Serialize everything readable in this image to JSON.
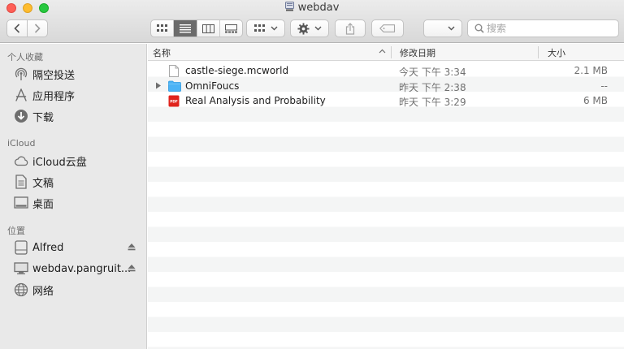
{
  "window": {
    "title": "webdav",
    "title_icon": "network-drive-icon"
  },
  "toolbar": {
    "nav": {
      "back_icon": "chevron-left-icon",
      "forward_icon": "chevron-right-icon"
    },
    "view_modes": [
      {
        "name": "icon-view",
        "icon": "grid-icon",
        "active": false
      },
      {
        "name": "list-view",
        "icon": "list-icon",
        "active": true
      },
      {
        "name": "column-view",
        "icon": "columns-icon",
        "active": false
      },
      {
        "name": "gallery-view",
        "icon": "gallery-icon",
        "active": false
      }
    ],
    "group_icon": "group-grid-icon",
    "action_icon": "gear-icon",
    "share_icon": "share-icon",
    "tag_icon": "tag-icon",
    "search": {
      "placeholder": "搜索",
      "value": ""
    }
  },
  "sidebar": {
    "sections": [
      {
        "title": "个人收藏",
        "items": [
          {
            "label": "隔空投送",
            "icon": "airdrop-icon"
          },
          {
            "label": "应用程序",
            "icon": "applications-icon"
          },
          {
            "label": "下载",
            "icon": "download-icon"
          }
        ]
      },
      {
        "title": "iCloud",
        "items": [
          {
            "label": "iCloud云盘",
            "icon": "cloud-icon"
          },
          {
            "label": "文稿",
            "icon": "document-icon"
          },
          {
            "label": "桌面",
            "icon": "desktop-icon"
          }
        ]
      },
      {
        "title": "位置",
        "items": [
          {
            "label": "Alfred",
            "icon": "disk-icon",
            "ejectable": true
          },
          {
            "label": "webdav.pangruit...",
            "icon": "monitor-icon",
            "ejectable": true
          },
          {
            "label": "网络",
            "icon": "network-globe-icon"
          }
        ]
      }
    ]
  },
  "list": {
    "columns": {
      "name": "名称",
      "date": "修改日期",
      "size": "大小"
    },
    "files": [
      {
        "name": "castle-siege.mcworld",
        "date": "今天 下午 3:34",
        "size": "2.1 MB",
        "kind": "file",
        "icon": "file-icon"
      },
      {
        "name": "OmniFoucs",
        "date": "昨天 下午 2:38",
        "size": "--",
        "kind": "folder",
        "icon": "folder-icon"
      },
      {
        "name": "Real Analysis and Probability",
        "date": "昨天 下午 3:29",
        "size": "6 MB",
        "kind": "pdf",
        "icon": "pdf-icon",
        "badge": "PDF"
      }
    ]
  },
  "colors": {
    "accent_folder": "#4bb3f5",
    "pdf_red": "#e0231c",
    "close": "#fe5f57",
    "minimize": "#febc2e",
    "maximize": "#28c840"
  }
}
